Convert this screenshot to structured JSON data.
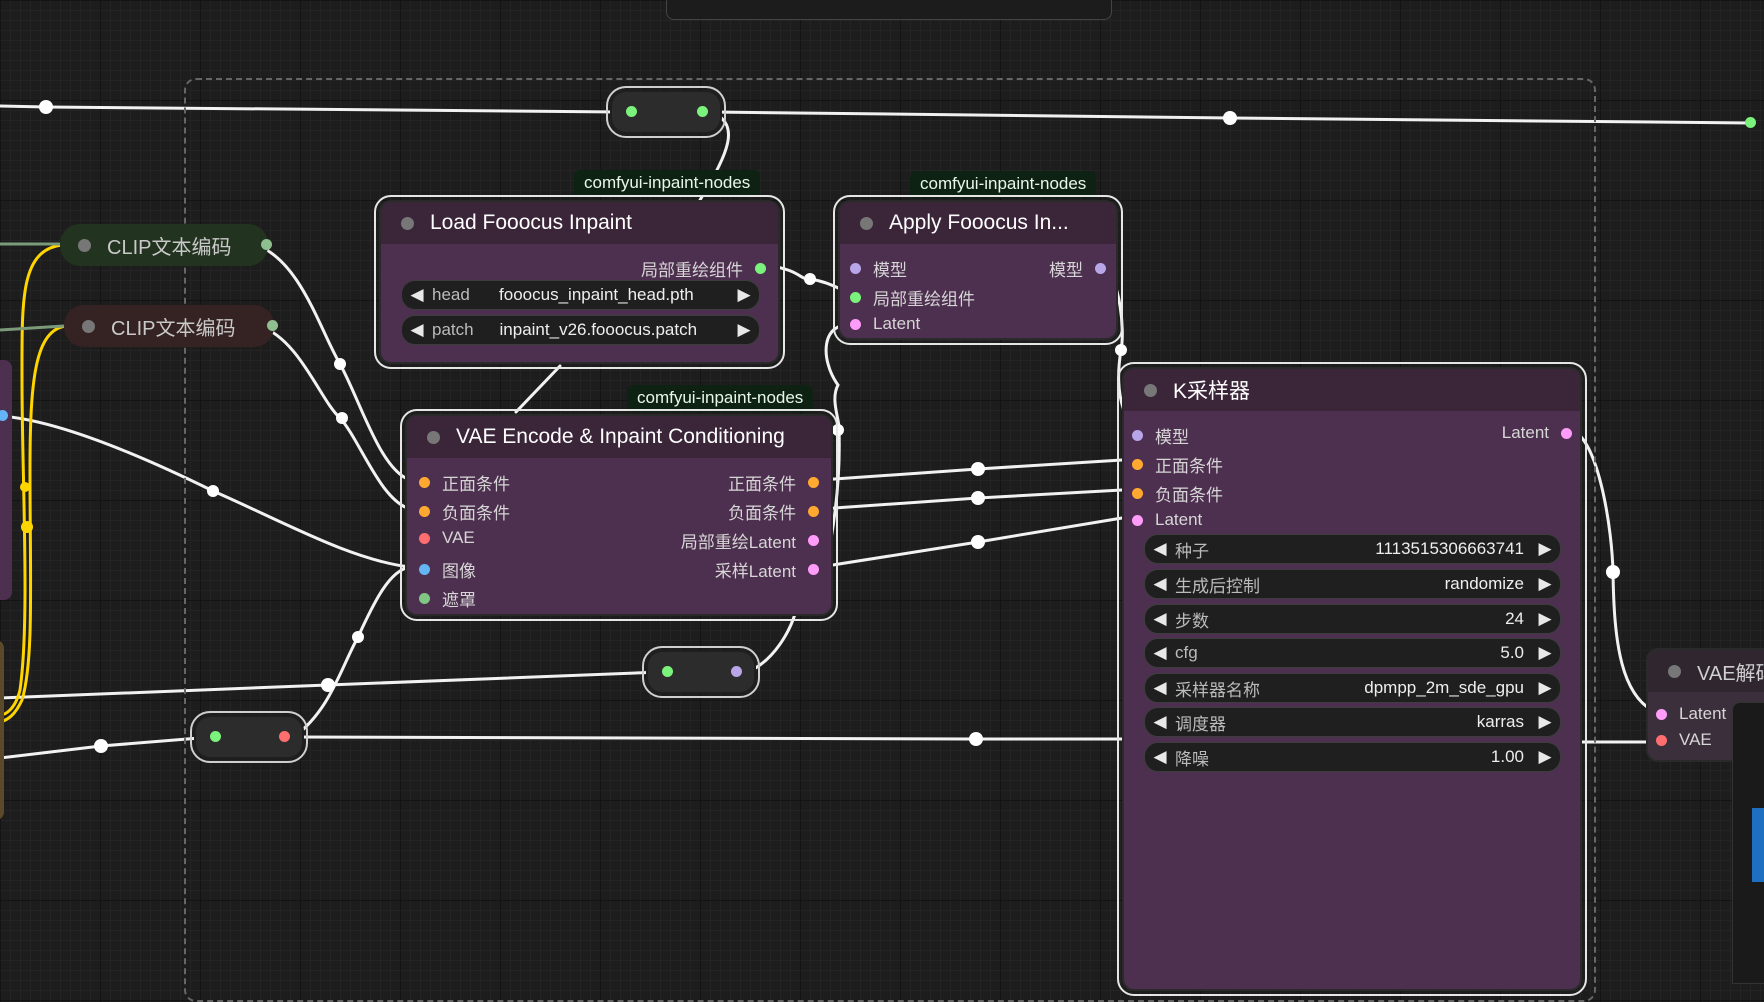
{
  "tags": {
    "load": "comfyui-inpaint-nodes",
    "apply": "comfyui-inpaint-nodes",
    "vae_encode": "comfyui-inpaint-nodes"
  },
  "clip_nodes": [
    {
      "title": "CLIP文本编码"
    },
    {
      "title": "CLIP文本编码"
    }
  ],
  "load_fooocus": {
    "title": "Load Fooocus Inpaint",
    "output": "局部重绘组件",
    "widgets": [
      {
        "name": "head",
        "value": "fooocus_inpaint_head.pth"
      },
      {
        "name": "patch",
        "value": "inpaint_v26.fooocus.patch"
      }
    ]
  },
  "apply_fooocus": {
    "title": "Apply Fooocus In...",
    "inputs": [
      "模型",
      "局部重绘组件",
      "Latent"
    ],
    "output": "模型"
  },
  "vae_encode": {
    "title": "VAE Encode & Inpaint Conditioning",
    "inputs": [
      "正面条件",
      "负面条件",
      "VAE",
      "图像",
      "遮罩"
    ],
    "outputs": [
      "正面条件",
      "负面条件",
      "局部重绘Latent",
      "采样Latent"
    ]
  },
  "ksampler": {
    "title": "K采样器",
    "inputs": [
      "模型",
      "正面条件",
      "负面条件",
      "Latent"
    ],
    "output": "Latent",
    "widgets": [
      {
        "name": "种子",
        "value": "1113515306663741"
      },
      {
        "name": "生成后控制",
        "value": "randomize"
      },
      {
        "name": "步数",
        "value": "24"
      },
      {
        "name": "cfg",
        "value": "5.0"
      },
      {
        "name": "采样器名称",
        "value": "dpmpp_2m_sde_gpu"
      },
      {
        "name": "调度器",
        "value": "karras"
      },
      {
        "name": "降噪",
        "value": "1.00"
      }
    ]
  },
  "vae_decode": {
    "title": "VAE解码",
    "inputs": [
      "Latent",
      "VAE"
    ]
  },
  "colors": {
    "model": "#b8a6e8",
    "conditioning": "#ffa931",
    "vae": "#ff6e6e",
    "latent": "#ff9cf9",
    "image": "#64b5f6",
    "mask": "#81c784",
    "inpaint_patch": "#7bf27b",
    "clip_text": "#ffd500",
    "node_body": "#4d2f4f",
    "node_title": "#3a2539"
  }
}
